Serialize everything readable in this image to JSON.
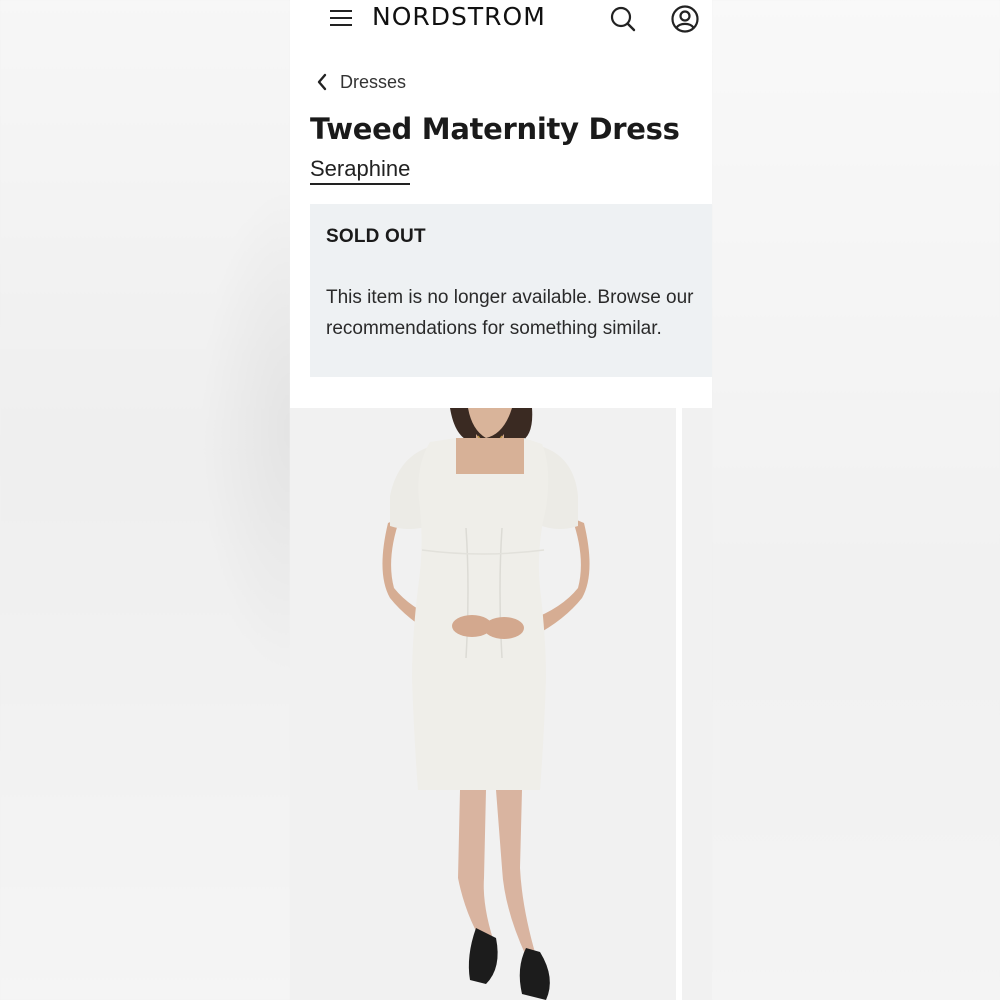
{
  "header": {
    "logo": "NORDSTROM",
    "menu_icon": "hamburger-menu-icon",
    "search_icon": "search-icon",
    "account_icon": "account-icon"
  },
  "breadcrumb": {
    "label": "Dresses",
    "icon": "chevron-left-icon"
  },
  "product": {
    "title": "Tweed Maternity Dress",
    "brand": "Seraphine"
  },
  "availability": {
    "status": "SOLD OUT",
    "message_line1": "This item is no longer available. Browse our",
    "message_line2": "recommendations for something similar."
  },
  "colors": {
    "banner_bg": "#eef1f3",
    "text": "#222222",
    "image_bg": "#f1f1f1"
  }
}
